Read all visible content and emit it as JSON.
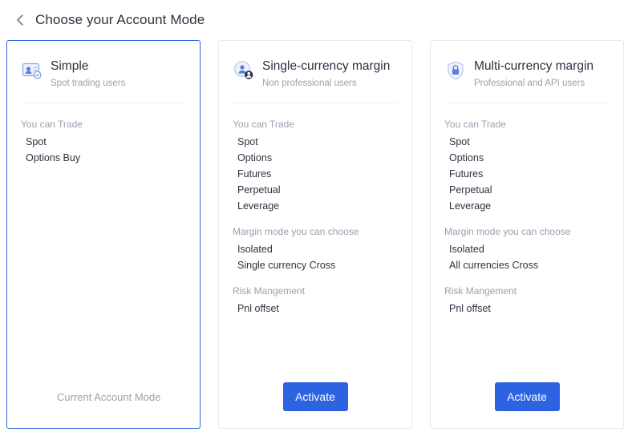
{
  "header": {
    "back_icon": "chevron-left-icon",
    "title": "Choose your Account Mode"
  },
  "colors": {
    "accent": "#2d63e0",
    "selected_border": "#2d63e0",
    "card_border": "#e8e9ed",
    "text_primary": "#2e3240",
    "text_muted": "#9aa0ae",
    "icon_fill": "#5b7cde"
  },
  "cards": [
    {
      "id": "simple",
      "icon": "id-card-person-icon",
      "title": "Simple",
      "subtitle": "Spot trading users",
      "selected": true,
      "sections": [
        {
          "title": "You can Trade",
          "items": [
            "Spot",
            "Options Buy"
          ]
        }
      ],
      "footer_label": "Current Account Mode",
      "has_button": false
    },
    {
      "id": "single-currency-margin",
      "icon": "user-badge-icon",
      "title": "Single-currency margin",
      "subtitle": "Non professional users",
      "selected": false,
      "sections": [
        {
          "title": "You can Trade",
          "items": [
            "Spot",
            "Options",
            "Futures",
            "Perpetual",
            "Leverage"
          ]
        },
        {
          "title": "Margin mode you can choose",
          "items": [
            "Isolated",
            "Single currency Cross"
          ]
        },
        {
          "title": "Risk Mangement",
          "items": [
            "Pnl offset"
          ]
        }
      ],
      "button_label": "Activate",
      "has_button": true
    },
    {
      "id": "multi-currency-margin",
      "icon": "shield-lock-icon",
      "title": "Multi-currency margin",
      "subtitle": "Professional and API users",
      "selected": false,
      "sections": [
        {
          "title": "You can Trade",
          "items": [
            "Spot",
            "Options",
            "Futures",
            "Perpetual",
            "Leverage"
          ]
        },
        {
          "title": "Margin mode you can choose",
          "items": [
            "Isolated",
            "All currencies Cross"
          ]
        },
        {
          "title": "Risk Mangement",
          "items": [
            "Pnl offset"
          ]
        }
      ],
      "button_label": "Activate",
      "has_button": true
    }
  ]
}
